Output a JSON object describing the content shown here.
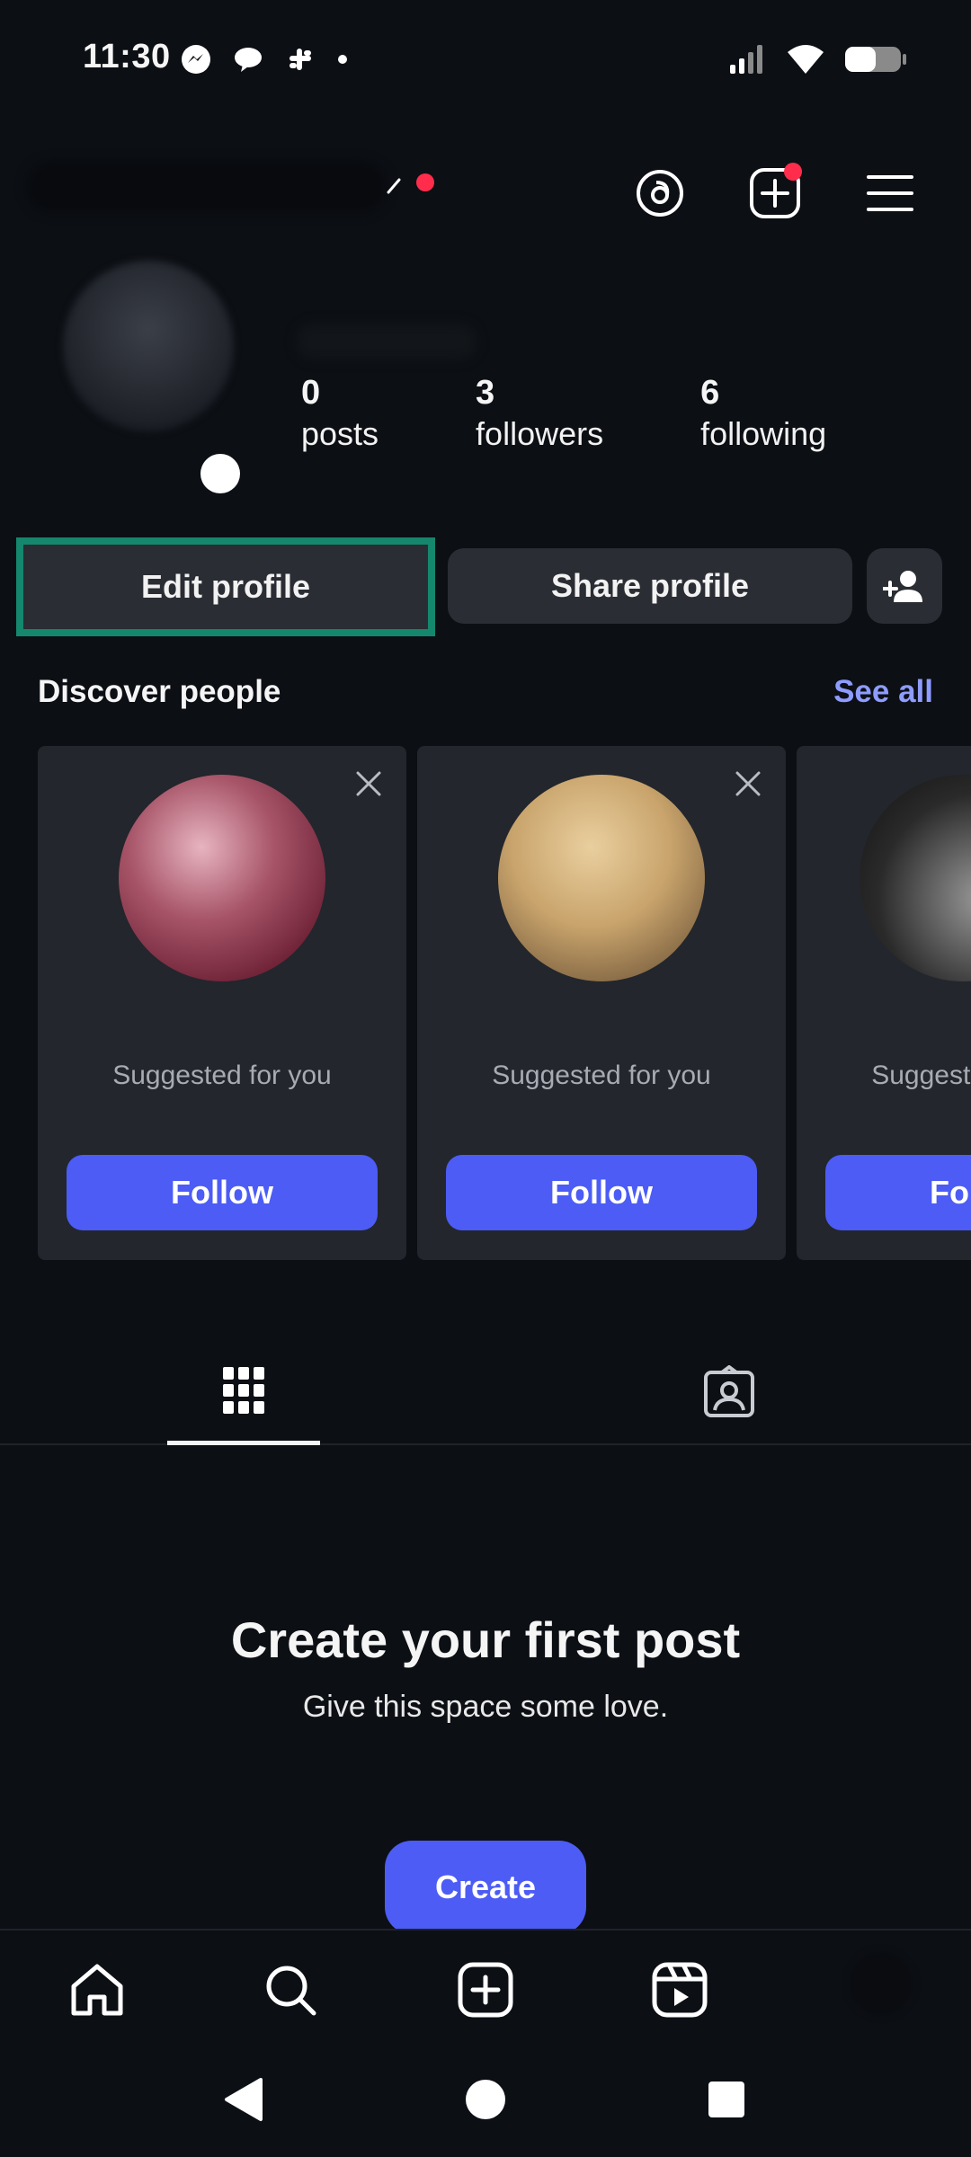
{
  "status_bar": {
    "time": "11:30",
    "icons": [
      "messenger-icon",
      "chat-bubble-icon",
      "slack-icon",
      "dot-icon",
      "signal-icon",
      "wifi-icon",
      "battery-icon"
    ]
  },
  "header": {
    "icons": [
      "threads-icon",
      "new-post-icon",
      "menu-icon"
    ]
  },
  "profile": {
    "stats": [
      {
        "number": "0",
        "label": "posts"
      },
      {
        "number": "3",
        "label": "followers"
      },
      {
        "number": "6",
        "label": "following"
      }
    ]
  },
  "actions": {
    "edit_label": "Edit profile",
    "share_label": "Share profile"
  },
  "discover": {
    "title": "Discover people",
    "see_all": "See all",
    "cards": [
      {
        "subtitle": "Suggested for you",
        "follow_label": "Follow"
      },
      {
        "subtitle": "Suggested for you",
        "follow_label": "Follow"
      },
      {
        "subtitle": "Suggested for you",
        "follow_label": "Follow"
      }
    ]
  },
  "tabs": [
    "grid-icon",
    "tagged-icon"
  ],
  "empty_state": {
    "title": "Create your first post",
    "subtitle": "Give this space some love.",
    "button": "Create"
  },
  "bottom_nav": [
    "home-icon",
    "search-icon",
    "create-icon",
    "reels-icon",
    "profile-avatar"
  ],
  "colors": {
    "background": "#0c0f14",
    "button_bg": "#2a2d33",
    "accent": "#4c5cf5",
    "link": "#8e9cff",
    "highlight_border": "#14876d",
    "notification": "#ff2d4b"
  }
}
